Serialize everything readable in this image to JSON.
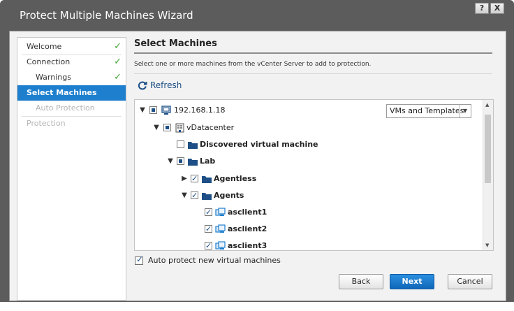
{
  "window": {
    "title": "Protect Multiple Machines Wizard",
    "help_label": "?",
    "close_label": "X"
  },
  "steps": [
    {
      "label": "Welcome",
      "state": "done"
    },
    {
      "label": "Connection",
      "state": "done"
    },
    {
      "label": "Warnings",
      "state": "done"
    },
    {
      "label": "Select Machines",
      "state": "active"
    },
    {
      "label": "Auto Protection",
      "state": "disabled"
    },
    {
      "label": "Protection",
      "state": "disabled"
    }
  ],
  "check_glyph": "✓",
  "page": {
    "heading": "Select Machines",
    "description": "Select one or more machines from the vCenter Server to add to protection.",
    "refresh_label": "Refresh"
  },
  "view_select": {
    "value": "VMs and Templates"
  },
  "tree": [
    {
      "label": "192.168.1.18",
      "expanded": true,
      "check": "partial",
      "icon": "host-icon"
    },
    {
      "label": "vDatacenter",
      "expanded": true,
      "check": "partial",
      "icon": "datacenter-icon"
    },
    {
      "label": "Discovered virtual machine",
      "check": "unchecked",
      "icon": "folder-icon"
    },
    {
      "label": "Lab",
      "expanded": true,
      "check": "partial",
      "icon": "folder-icon"
    },
    {
      "label": "Agentless",
      "expanded": false,
      "check": "checked",
      "icon": "folder-icon"
    },
    {
      "label": "Agents",
      "expanded": true,
      "check": "checked",
      "icon": "folder-icon"
    },
    {
      "label": "asclient1",
      "check": "checked",
      "icon": "vm-icon"
    },
    {
      "label": "asclient2",
      "check": "checked",
      "icon": "vm-icon"
    },
    {
      "label": "asclient3",
      "check": "checked",
      "icon": "vm-icon"
    }
  ],
  "auto_protect": {
    "label": "Auto protect new virtual machines",
    "checked": true
  },
  "buttons": {
    "back": "Back",
    "next": "Next",
    "cancel": "Cancel"
  },
  "colors": {
    "accent": "#1e7fce",
    "check_green": "#3fa733",
    "folder_blue": "#1d4f86"
  }
}
